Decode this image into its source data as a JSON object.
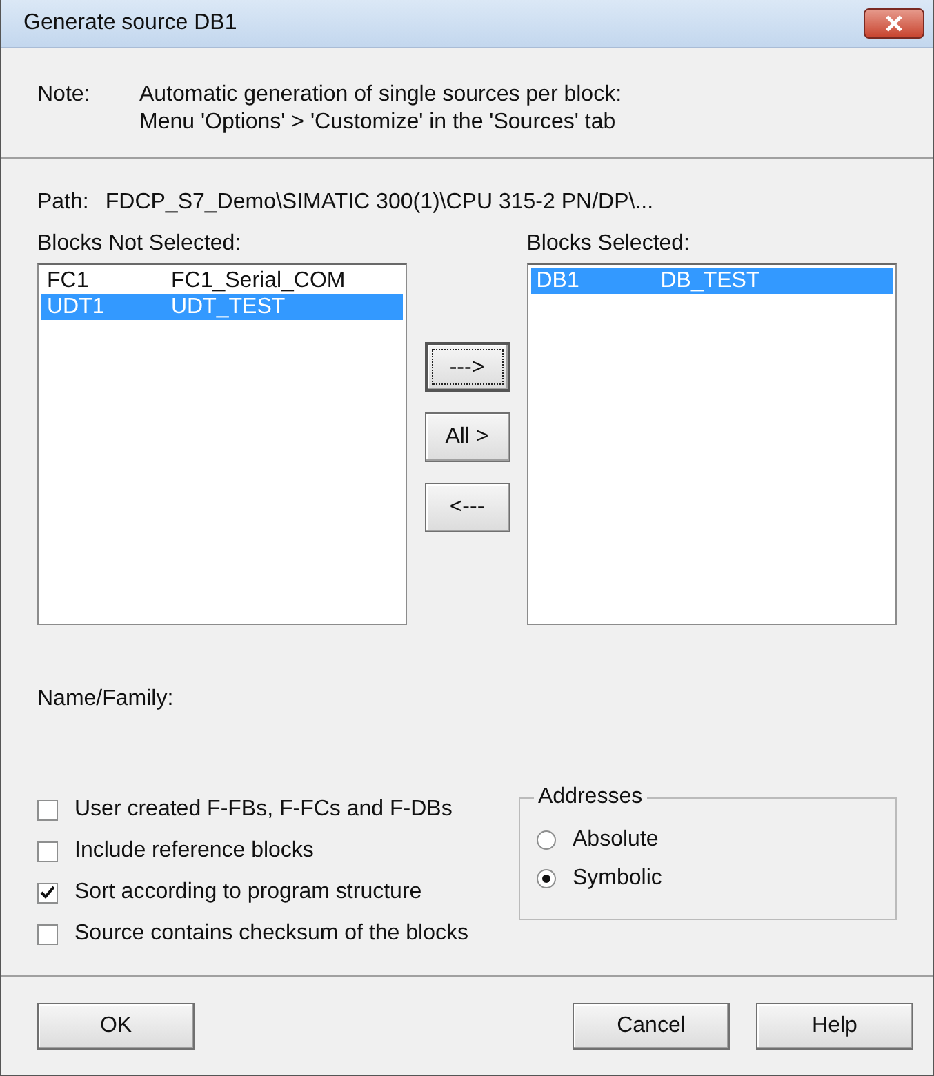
{
  "window": {
    "title": "Generate source DB1"
  },
  "note": {
    "label": "Note:",
    "lines": [
      "Automatic generation of single sources per block:",
      "Menu 'Options' > 'Customize' in the 'Sources' tab"
    ]
  },
  "path": {
    "label": "Path:",
    "value": "FDCP_S7_Demo\\SIMATIC 300(1)\\CPU 315-2 PN/DP\\..."
  },
  "blocks_not_selected": {
    "label": "Blocks Not Selected:",
    "items": [
      {
        "name": "FC1",
        "symbol": "FC1_Serial_COM",
        "selected": false
      },
      {
        "name": "UDT1",
        "symbol": "UDT_TEST",
        "selected": true
      }
    ]
  },
  "move_buttons": [
    {
      "label": "--->",
      "focused": true
    },
    {
      "label": "All >",
      "focused": false
    },
    {
      "label": "<---",
      "focused": false
    }
  ],
  "blocks_selected": {
    "label": "Blocks Selected:",
    "items": [
      {
        "name": "DB1",
        "symbol": "DB_TEST",
        "selected": true
      }
    ]
  },
  "name_family": {
    "label": "Name/Family:"
  },
  "options": [
    {
      "label": "User created F-FBs, F-FCs and F-DBs",
      "checked": false
    },
    {
      "label": "Include reference blocks",
      "checked": false
    },
    {
      "label": "Sort according to program structure",
      "checked": true
    },
    {
      "label": "Source contains checksum of the blocks",
      "checked": false
    }
  ],
  "addresses": {
    "title": "Addresses",
    "options": [
      {
        "label": "Absolute",
        "selected": false
      },
      {
        "label": "Symbolic",
        "selected": true
      }
    ]
  },
  "buttons": [
    {
      "label": "OK"
    },
    {
      "label": "Cancel"
    },
    {
      "label": "Help"
    }
  ]
}
